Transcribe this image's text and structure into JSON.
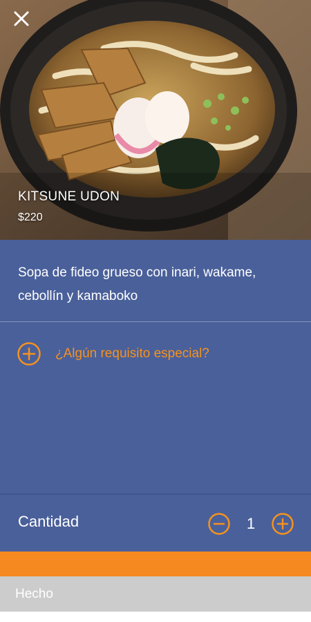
{
  "header": {
    "close_icon": "close-icon"
  },
  "dish": {
    "name": "KITSUNE UDON",
    "price": "$220",
    "description": "Sopa de fideo grueso con inari, wakame, cebollín y kamaboko"
  },
  "special_request": {
    "icon": "plus-circle-icon",
    "label": "¿Algún requisito especial?"
  },
  "quantity": {
    "label": "Cantidad",
    "value": "1",
    "decrement_icon": "minus-circle-icon",
    "increment_icon": "plus-circle-icon"
  },
  "footer": {
    "done_label": "Hecho"
  },
  "colors": {
    "panel": "#4a609a",
    "accent": "#f6891f",
    "done_bar": "#cccccc"
  }
}
